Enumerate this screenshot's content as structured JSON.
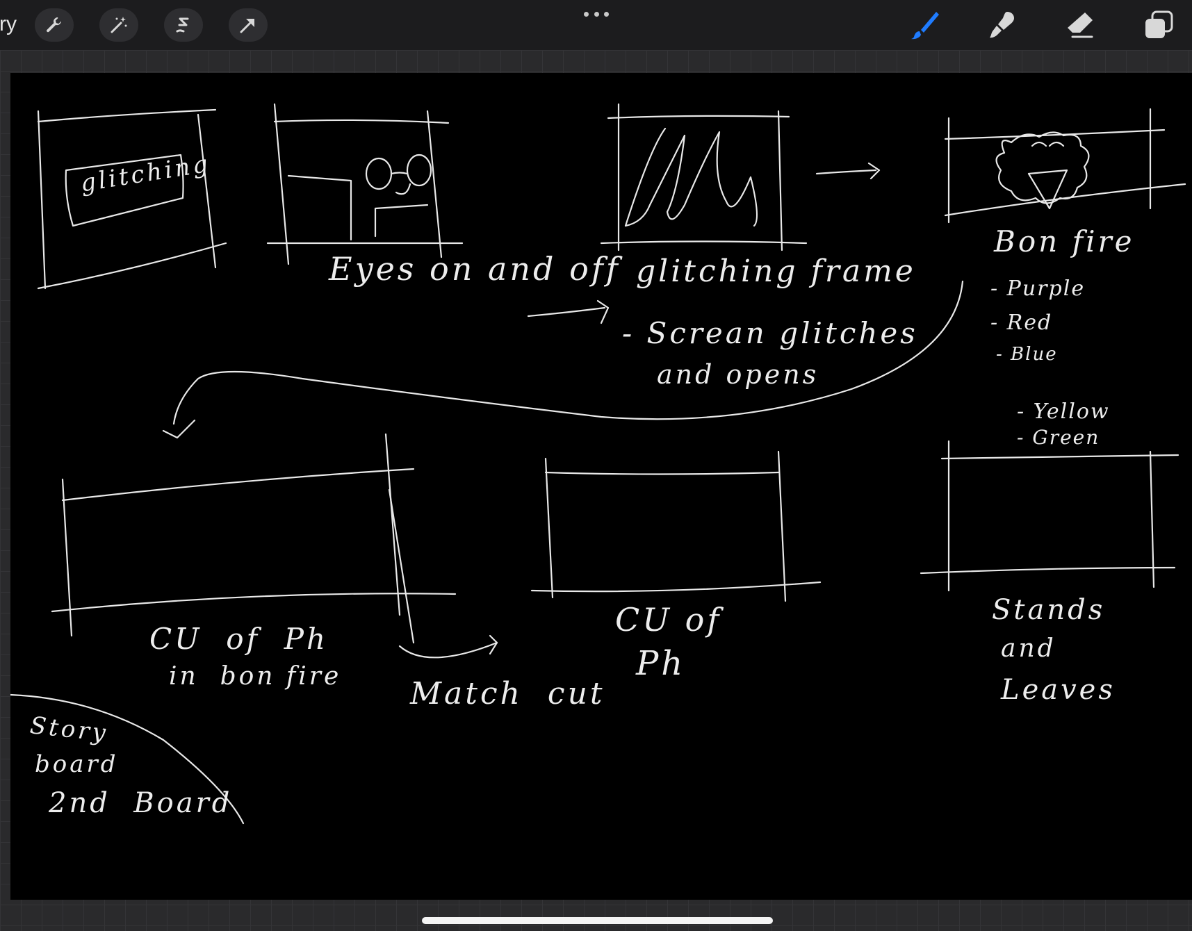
{
  "app": {
    "gallery_label": "Gallery"
  },
  "toolbar": {
    "left_tools": [
      "wrench-icon",
      "magic-wand-icon",
      "selection-icon",
      "transform-arrow-icon"
    ],
    "right_tools": [
      "brush-icon",
      "smudge-icon",
      "eraser-icon",
      "layers-icon"
    ],
    "active_tool": "brush-icon",
    "accent_color": "#1f7cff"
  },
  "canvas": {
    "background": "#000000",
    "notes": {
      "glitching_box": "glitching",
      "panel2_caption": "Eyes on and off",
      "panel3_caption": "glitching frame",
      "screen_note_1": "- Screan glitches",
      "screen_note_2": "and opens",
      "bonfire_title": "Bon fire",
      "color_purple": "- Purple",
      "color_red": "- Red",
      "color_blue": "- Blue",
      "color_yellow": "- Yellow",
      "color_green": "- Green",
      "cu_bonfire_1": "CU  of  Ph",
      "cu_bonfire_2": "in  bon fire",
      "match_cut": "Match  cut",
      "cu_ph_1": "CU of",
      "cu_ph_2": "Ph",
      "stands_1": "Stands",
      "stands_2": "and",
      "stands_3": "Leaves",
      "story_1": "Story",
      "story_2": "board",
      "story_3": "2nd  Board"
    }
  }
}
